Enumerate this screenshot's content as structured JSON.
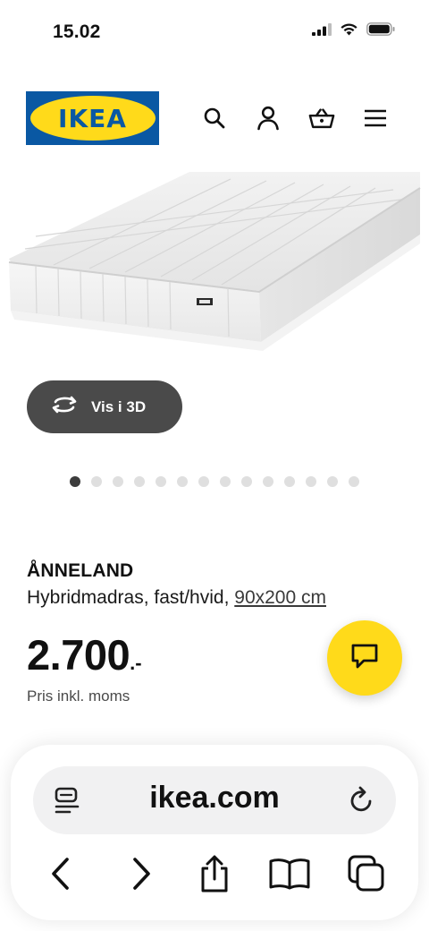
{
  "status_bar": {
    "time": "15.02",
    "icons": [
      "cellular-signal-icon",
      "wifi-icon",
      "battery-icon"
    ]
  },
  "header": {
    "logo_text": "IKEA",
    "icons": [
      "search-icon",
      "account-icon",
      "shopping-basket-icon",
      "menu-icon"
    ]
  },
  "gallery": {
    "view_3d_label": "Vis i 3D",
    "image_count": 14,
    "active_index": 0
  },
  "product": {
    "name": "ÅNNELAND",
    "description": "Hybridmadras, fast/hvid, ",
    "size": "90x200 cm",
    "price": "2.700",
    "price_suffix": ".-",
    "price_note": "Pris inkl. moms"
  },
  "browser": {
    "url": "ikea.com",
    "icons": [
      "reader-icon",
      "reload-icon",
      "back-icon",
      "forward-icon",
      "share-icon",
      "bookmarks-icon",
      "tabs-icon"
    ]
  },
  "colors": {
    "ikea_blue": "#0a58a3",
    "ikea_yellow": "#ffda1a",
    "button_dark": "#4a4a4a"
  }
}
